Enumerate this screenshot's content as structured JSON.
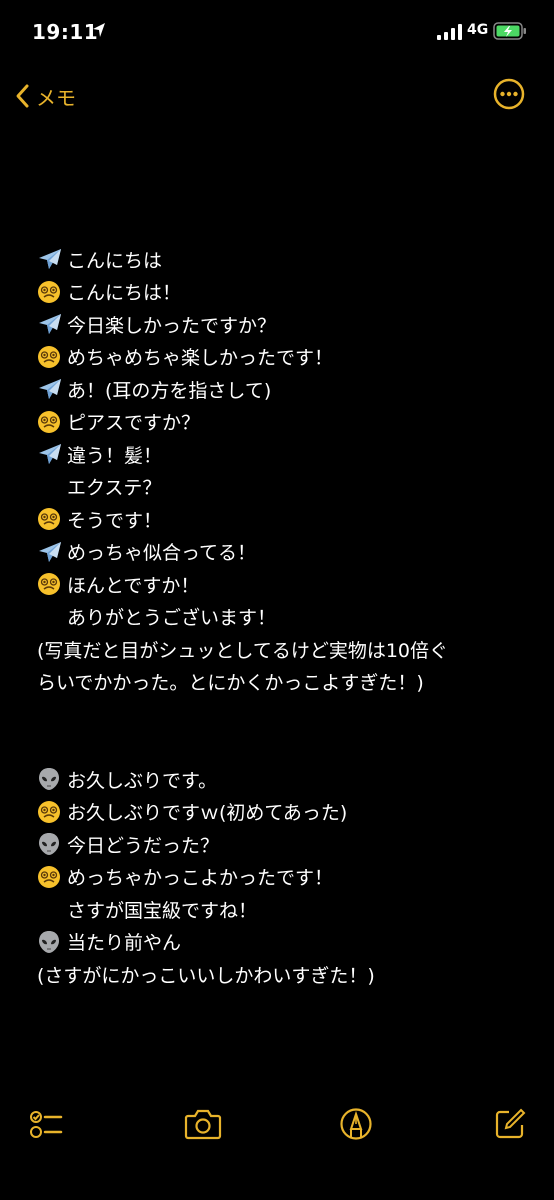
{
  "status": {
    "time": "19:11",
    "network": "4G",
    "icons": [
      "location-arrow-icon",
      "signal-bars-icon",
      "battery-charging-icon"
    ]
  },
  "nav": {
    "back_label": "メモ",
    "back_icon": "chevron-left-icon",
    "more_icon": "ellipsis-circle-icon"
  },
  "accent_color": "#e8b32b",
  "note": {
    "lines": [
      {
        "emoji": "airplane",
        "text": "こんにちは"
      },
      {
        "emoji": "dizzy",
        "text": "こんにちは！"
      },
      {
        "emoji": "airplane",
        "text": "今日楽しかったですか？"
      },
      {
        "emoji": "dizzy",
        "text": "めちゃめちゃ楽しかったです！"
      },
      {
        "emoji": "airplane",
        "text": "あ！(耳の方を指さして)"
      },
      {
        "emoji": "dizzy",
        "text": "ピアスですか？"
      },
      {
        "emoji": "airplane",
        "text": "違う！髪！"
      },
      {
        "emoji": "",
        "text": "エクステ？"
      },
      {
        "emoji": "dizzy",
        "text": "そうです！"
      },
      {
        "emoji": "airplane",
        "text": "めっちゃ似合ってる！"
      },
      {
        "emoji": "dizzy",
        "text": "ほんとですか！"
      },
      {
        "emoji": "",
        "text": "ありがとうございます！"
      },
      {
        "emoji": "none",
        "text": "(写真だと目がシュッとしてるけど実物は10倍ぐ"
      },
      {
        "emoji": "none",
        "text": "らいでかかった。とにかくかっこよすぎた！)"
      },
      {
        "emoji": "none",
        "text": ""
      },
      {
        "emoji": "none",
        "text": ""
      },
      {
        "emoji": "alien",
        "text": "お久しぶりです。"
      },
      {
        "emoji": "dizzy",
        "text": "お久しぶりですｗ(初めてあった)"
      },
      {
        "emoji": "alien",
        "text": "今日どうだった？"
      },
      {
        "emoji": "dizzy",
        "text": "めっちゃかっこよかったです！"
      },
      {
        "emoji": "",
        "text": "さすが国宝級ですね！"
      },
      {
        "emoji": "alien",
        "text": "当たり前やん"
      },
      {
        "emoji": "none",
        "text": "(さすがにかっこいいしかわいすぎた！)"
      }
    ]
  },
  "toolbar": {
    "items": [
      "checklist-icon",
      "camera-icon",
      "markup-pen-icon",
      "compose-icon"
    ]
  }
}
